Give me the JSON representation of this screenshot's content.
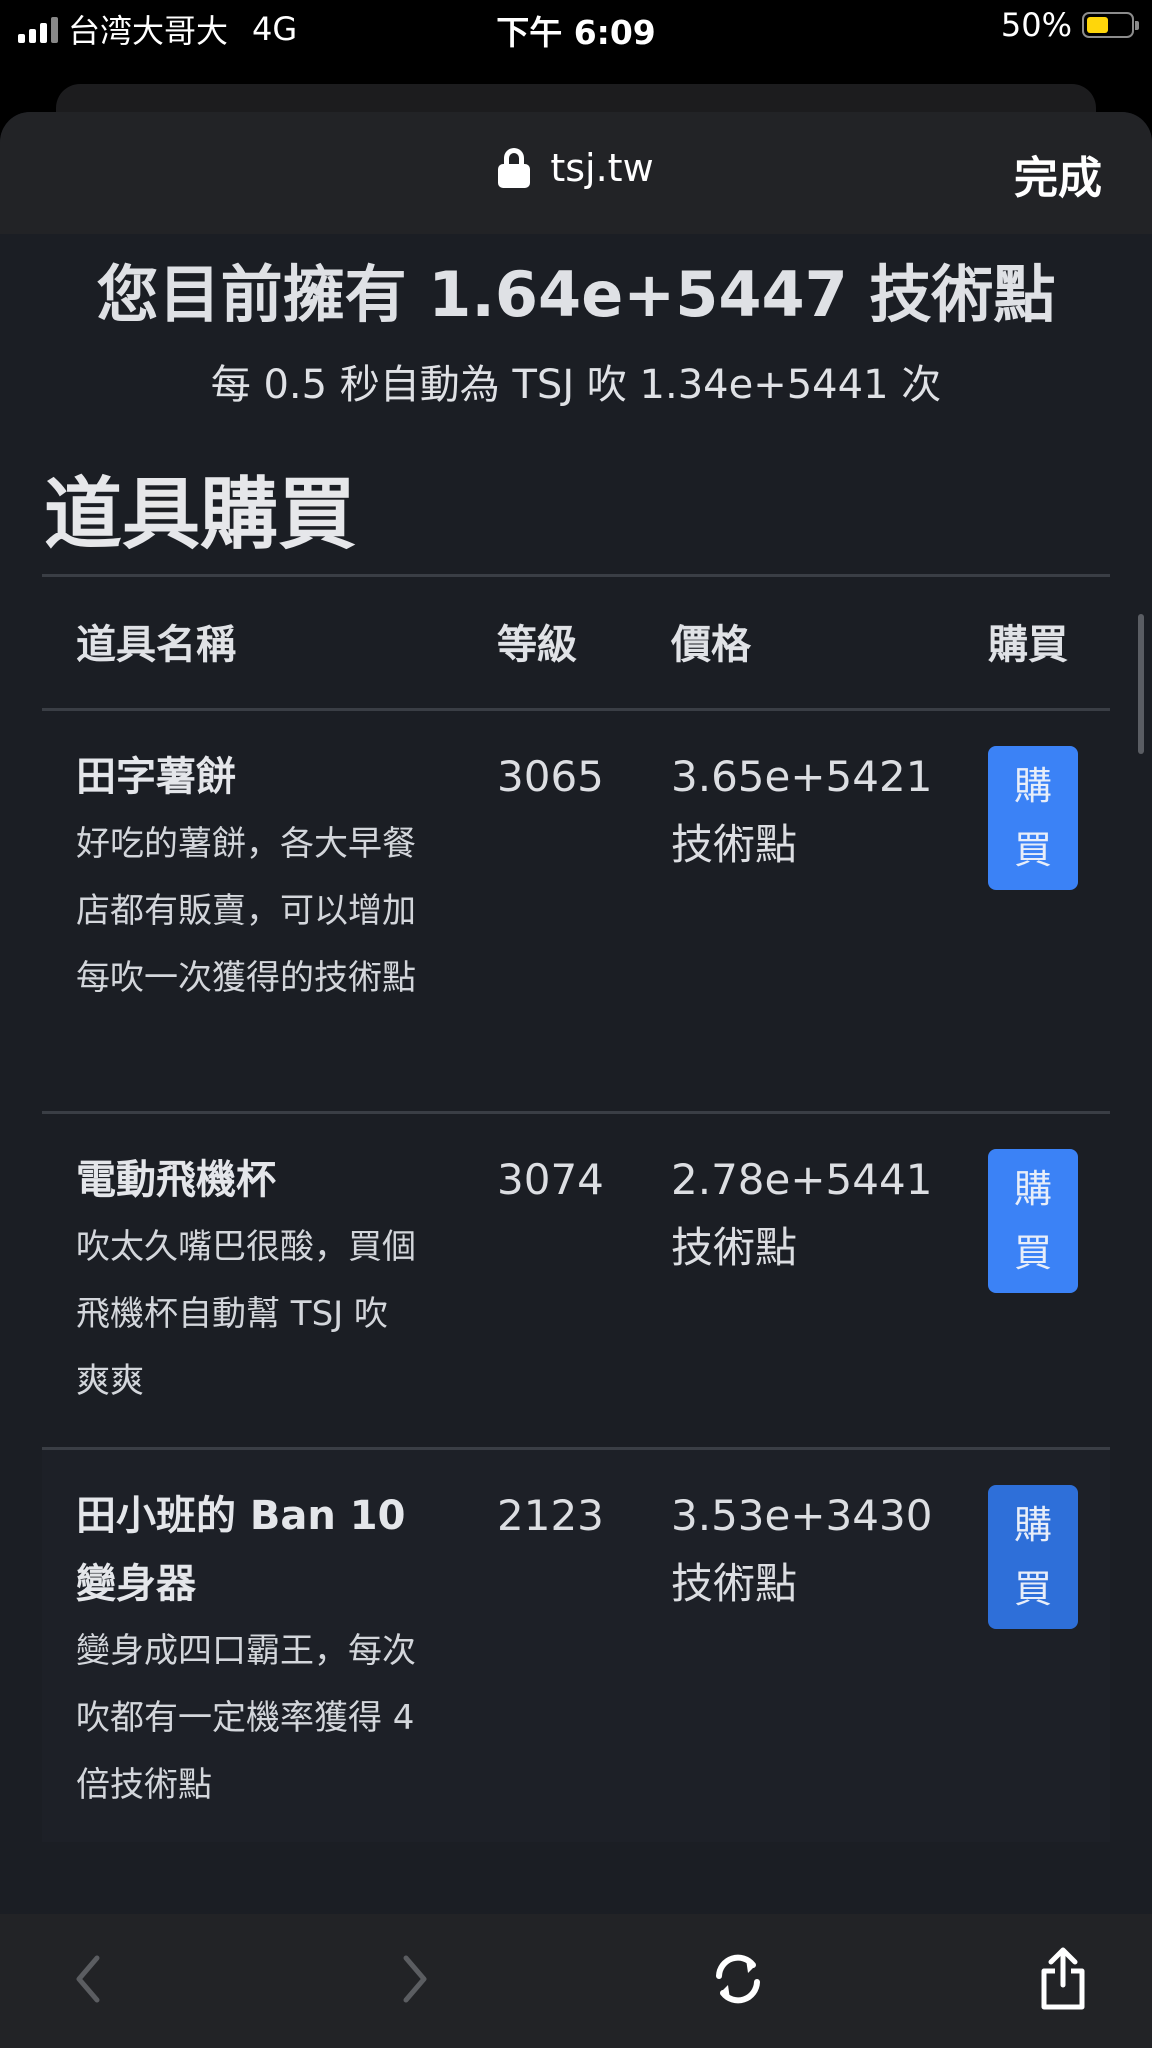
{
  "status_bar": {
    "carrier": "台湾大哥大",
    "network": "4G",
    "time": "下午 6:09",
    "battery": "50%",
    "battery_level": 0.5,
    "battery_color": "#ffd60a"
  },
  "browser": {
    "url": "tsj.tw",
    "done_label": "完成"
  },
  "summary": {
    "points_text": "您目前擁有 1.64e+5447 技術點",
    "rate_text": "每 0.5 秒自動為 TSJ 吹 1.34e+5441 次"
  },
  "shop": {
    "title": "道具購買",
    "headers": {
      "name": "道具名稱",
      "level": "等級",
      "price": "價格",
      "buy": "購買"
    },
    "items": [
      {
        "name": "田字薯餅",
        "desc": "好吃的薯餅，各大早餐店都有販賣，可以增加每吹一次獲得的技術點",
        "level": "3065",
        "price": "3.65e+5421",
        "unit": "技術點",
        "buy_label_1": "購",
        "buy_label_2": "買"
      },
      {
        "name": "電動飛機杯",
        "desc": "吹太久嘴巴很酸，買個飛機杯自動幫 TSJ 吹爽爽",
        "level": "3074",
        "price": "2.78e+5441",
        "unit": "技術點",
        "buy_label_1": "購",
        "buy_label_2": "買"
      },
      {
        "name": "田小班的 Ban 10 變身器",
        "desc": "變身成四口霸王，每次吹都有一定機率獲得 4 倍技術點",
        "level": "2123",
        "price": "3.53e+3430",
        "unit": "技術點",
        "buy_label_1": "購",
        "buy_label_2": "買"
      }
    ],
    "button_color": "#3b82f6"
  },
  "toolbar": {
    "icons": [
      "back-icon",
      "forward-icon",
      "reload-icon",
      "share-icon"
    ]
  }
}
